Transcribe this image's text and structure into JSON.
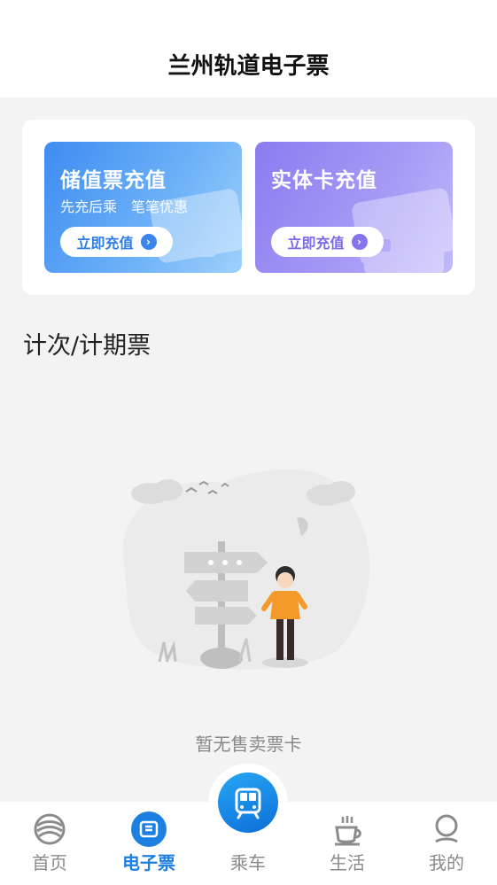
{
  "header": {
    "title": "兰州轨道电子票"
  },
  "topup_cards": [
    {
      "title": "储值票充值",
      "subtitle": "先充后乘　笔笔优惠",
      "button": "立即充值"
    },
    {
      "title": "实体卡充值",
      "subtitle": "",
      "button": "立即充值"
    }
  ],
  "section": {
    "title": "计次/计期票"
  },
  "empty_state": {
    "text": "暂无售卖票卡"
  },
  "tabbar": {
    "items": [
      {
        "label": "首页",
        "icon": "metro-logo-icon"
      },
      {
        "label": "电子票",
        "icon": "ticket-icon"
      },
      {
        "label": "乘车",
        "icon": "train-icon"
      },
      {
        "label": "生活",
        "icon": "coffee-cup-icon"
      },
      {
        "label": "我的",
        "icon": "user-icon"
      }
    ],
    "active": "电子票"
  },
  "colors": {
    "accent": "#1d7fe0",
    "stored_card": "#3f8cf2",
    "physical_card": "#8a7cf0"
  }
}
